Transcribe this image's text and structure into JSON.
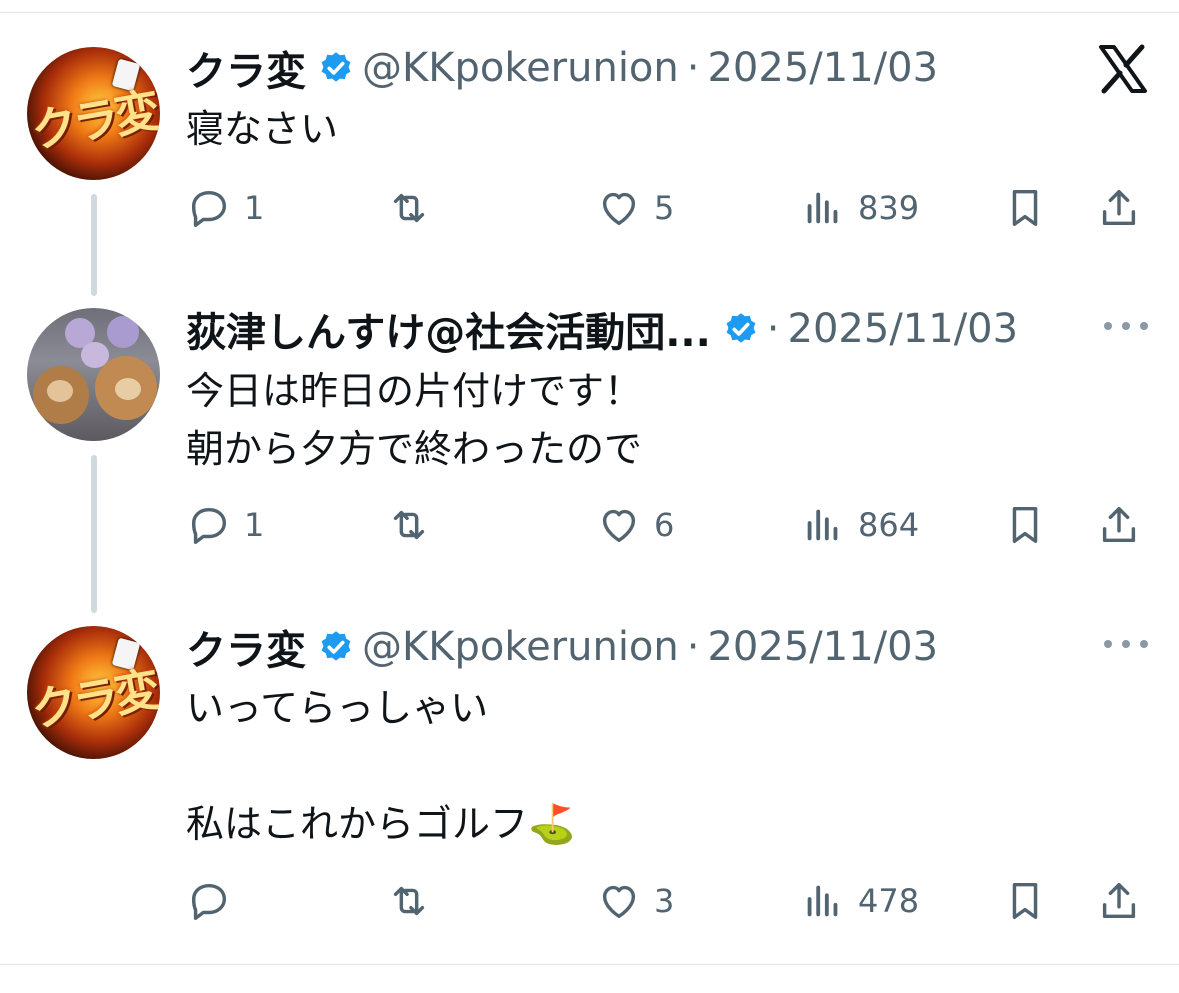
{
  "posts": [
    {
      "name": "クラ変",
      "handle": "@KKpokerunion",
      "separator": "·",
      "date": "2025/11/03",
      "text": "寝なさい",
      "avatar_text": "クラ変",
      "stats": {
        "replies": "1",
        "reposts": "",
        "likes": "5",
        "views": "839"
      }
    },
    {
      "name": "荻津しんすけ@社会活動団...",
      "handle": "",
      "separator": "·",
      "date": "2025/11/03",
      "text": "今日は昨日の片付けです！\n朝から夕方で終わったので",
      "stats": {
        "replies": "1",
        "reposts": "",
        "likes": "6",
        "views": "864"
      }
    },
    {
      "name": "クラ変",
      "handle": "@KKpokerunion",
      "separator": "·",
      "date": "2025/11/03",
      "text": "いってらっしゃい\n\n私はこれからゴルフ⛳",
      "avatar_text": "クラ変",
      "stats": {
        "replies": "",
        "reposts": "",
        "likes": "3",
        "views": "478"
      }
    }
  ],
  "icons": {
    "reply": "reply-icon",
    "repost": "repost-icon",
    "like": "heart-icon",
    "views": "views-icon",
    "bookmark": "bookmark-icon",
    "share": "share-icon",
    "verified": "verified-badge-icon",
    "brand": "x-logo-icon",
    "more": "more-icon"
  },
  "colors": {
    "text": "#0f1419",
    "muted": "#536471",
    "verified": "#1d9bf0",
    "thread_line": "#cfd9de"
  }
}
